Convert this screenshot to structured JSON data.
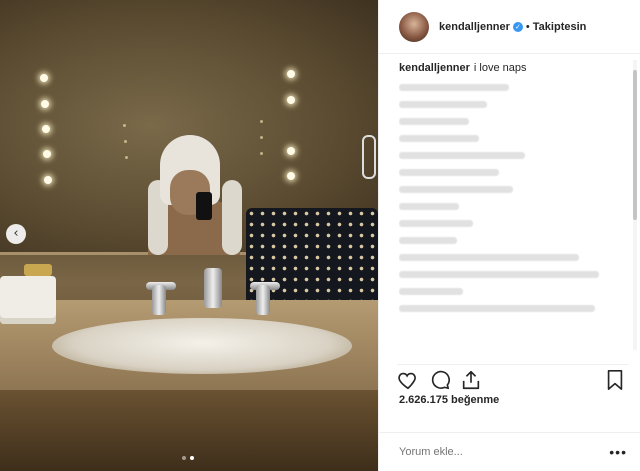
{
  "post": {
    "username": "kendalljenner",
    "separator": "•",
    "follow_label": "Takiptesin",
    "caption_user": "kendalljenner",
    "caption_text": "i love naps",
    "likes": "2.626.175 beğenme",
    "comment_placeholder": "Yorum ekle...",
    "more_label": "•••",
    "prev_arrow": "‹",
    "carousel_pages": 2,
    "carousel_active": 2
  },
  "icons": {
    "like": "heart-icon",
    "comment": "comment-icon",
    "share": "share-icon",
    "save": "bookmark-icon",
    "verified": "verified-badge-icon"
  },
  "colors": {
    "verified": "#3897f0",
    "text": "#262626",
    "muted": "#999999"
  }
}
